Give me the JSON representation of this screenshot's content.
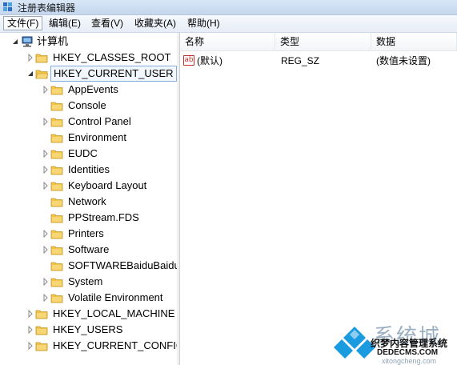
{
  "window": {
    "title": "注册表编辑器"
  },
  "menu": [
    {
      "label": "文件(F)"
    },
    {
      "label": "编辑(E)"
    },
    {
      "label": "查看(V)"
    },
    {
      "label": "收藏夹(A)"
    },
    {
      "label": "帮助(H)"
    }
  ],
  "tree": {
    "root": "计算机",
    "hives": [
      {
        "label": "HKEY_CLASSES_ROOT"
      },
      {
        "label": "HKEY_CURRENT_USER"
      }
    ],
    "current_user_children": [
      {
        "label": "AppEvents",
        "expandable": true
      },
      {
        "label": "Console",
        "expandable": false
      },
      {
        "label": "Control Panel",
        "expandable": true
      },
      {
        "label": "Environment",
        "expandable": false
      },
      {
        "label": "EUDC",
        "expandable": true
      },
      {
        "label": "Identities",
        "expandable": true
      },
      {
        "label": "Keyboard Layout",
        "expandable": true
      },
      {
        "label": "Network",
        "expandable": false
      },
      {
        "label": "PPStream.FDS",
        "expandable": false
      },
      {
        "label": "Printers",
        "expandable": true
      },
      {
        "label": "Software",
        "expandable": true
      },
      {
        "label": "SOFTWAREBaiduBaidu",
        "expandable": false
      },
      {
        "label": "System",
        "expandable": true
      },
      {
        "label": "Volatile Environment",
        "expandable": true
      }
    ],
    "other_hives": [
      {
        "label": "HKEY_LOCAL_MACHINE"
      },
      {
        "label": "HKEY_USERS"
      },
      {
        "label": "HKEY_CURRENT_CONFIG"
      }
    ]
  },
  "values_table": {
    "columns": [
      "名称",
      "类型",
      "数据"
    ],
    "rows": [
      {
        "name": "(默认)",
        "type": "REG_SZ",
        "data": "(数值未设置)"
      }
    ]
  },
  "watermark": {
    "big": "系统城",
    "line1": "织梦内容管理系统",
    "line2": "DEDECMS.COM",
    "line3": "xitongcheng.com"
  }
}
